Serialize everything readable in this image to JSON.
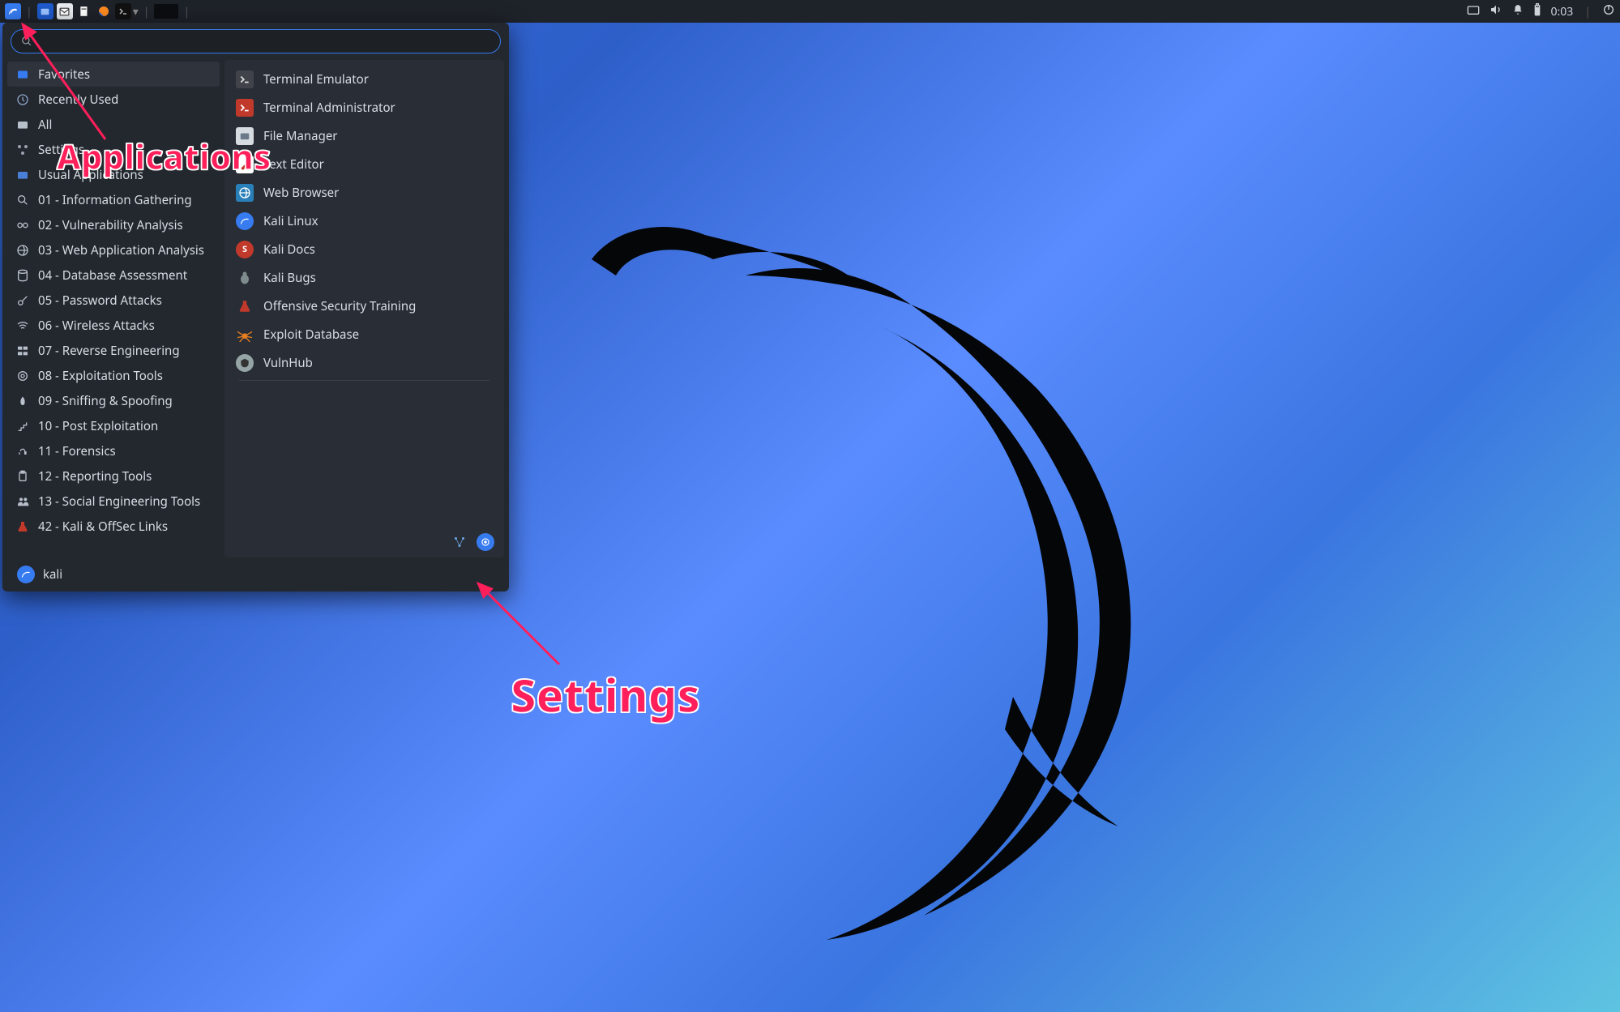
{
  "panel": {
    "clock": "0:03"
  },
  "search": {
    "placeholder": ""
  },
  "categories": [
    {
      "label": "Favorites",
      "icon": "star"
    },
    {
      "label": "Recently Used",
      "icon": "clock"
    },
    {
      "label": "All",
      "icon": "folder"
    },
    {
      "label": "Settings",
      "icon": "nodes"
    },
    {
      "label": "Usual Applications",
      "icon": "folder"
    },
    {
      "label": "01 - Information Gathering",
      "icon": "magnify"
    },
    {
      "label": "02 - Vulnerability Analysis",
      "icon": "link"
    },
    {
      "label": "03 - Web Application Analysis",
      "icon": "globe"
    },
    {
      "label": "04 - Database Assessment",
      "icon": "db"
    },
    {
      "label": "05 - Password Attacks",
      "icon": "key"
    },
    {
      "label": "06 - Wireless Attacks",
      "icon": "wifi"
    },
    {
      "label": "07 - Reverse Engineering",
      "icon": "bricks"
    },
    {
      "label": "08 - Exploitation Tools",
      "icon": "target"
    },
    {
      "label": "09 - Sniffing & Spoofing",
      "icon": "nose"
    },
    {
      "label": "10 - Post Exploitation",
      "icon": "stairs"
    },
    {
      "label": "11 - Forensics",
      "icon": "print"
    },
    {
      "label": "12 - Reporting Tools",
      "icon": "clip"
    },
    {
      "label": "13 - Social Engineering Tools",
      "icon": "people"
    },
    {
      "label": "42 - Kali & OffSec Links",
      "icon": "flask"
    }
  ],
  "apps": [
    {
      "label": "Terminal Emulator",
      "bg": "#40444a"
    },
    {
      "label": "Terminal Administrator",
      "bg": "#c0392b"
    },
    {
      "label": "File Manager",
      "bg": "#bdc3c7"
    },
    {
      "label": "Text Editor",
      "bg": "#3498db"
    },
    {
      "label": "Web Browser",
      "bg": "#2980b9"
    },
    {
      "label": "Kali Linux",
      "bg": "#367bf0"
    },
    {
      "label": "Kali Docs",
      "bg": "#c0392b"
    },
    {
      "label": "Kali Bugs",
      "bg": "#7f8c8d"
    },
    {
      "label": "Offensive Security Training",
      "bg": "#c0392b"
    },
    {
      "label": "Exploit Database",
      "bg": "#e67e22"
    },
    {
      "label": "VulnHub",
      "bg": "#95a5a6"
    }
  ],
  "user": {
    "name": "kali"
  },
  "annotations": {
    "applications": "Applications",
    "settings": "Settings"
  }
}
